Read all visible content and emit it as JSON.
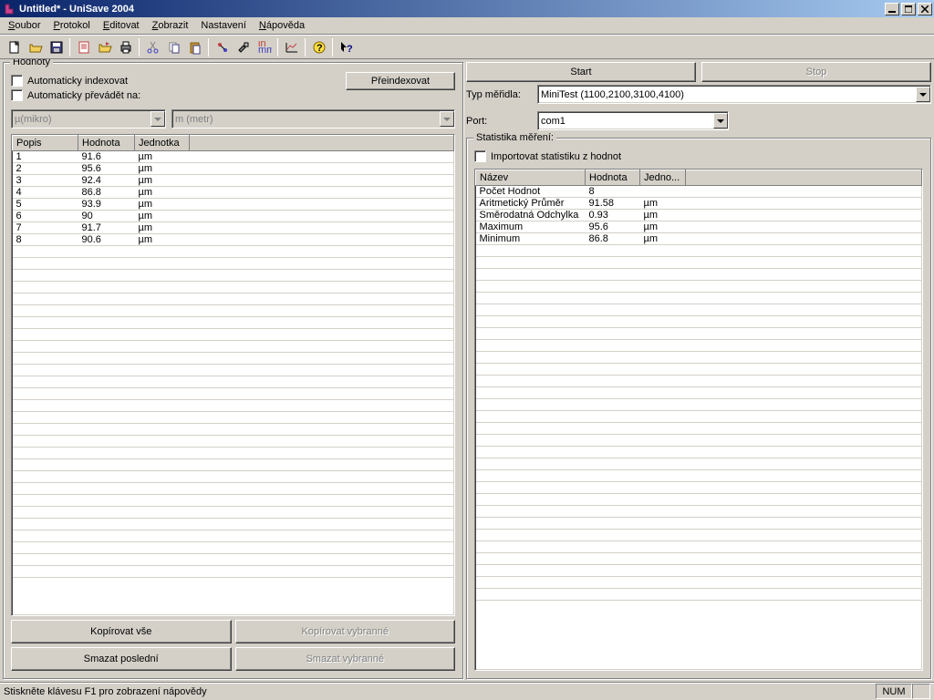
{
  "window": {
    "title": "Untitled* - UniSave 2004"
  },
  "menu": {
    "items": [
      {
        "label": "Soubor",
        "u": 0
      },
      {
        "label": "Protokol",
        "u": 0
      },
      {
        "label": "Editovat",
        "u": 0
      },
      {
        "label": "Zobrazit",
        "u": 0
      },
      {
        "label": "Nastavení",
        "u": -1
      },
      {
        "label": "Nápověda",
        "u": 0
      }
    ]
  },
  "left": {
    "group_title": "Hodnoty",
    "auto_index": "Automaticky indexovat",
    "reindex": "Přeindexovat",
    "auto_convert": "Automaticky převádět na:",
    "unit1": "µ(mikro)",
    "unit2": "m (metr)",
    "cols": [
      "Popis",
      "Hodnota",
      "Jednotka"
    ],
    "rows": [
      {
        "popis": "1",
        "hodnota": "91.6",
        "jednotka": "µm"
      },
      {
        "popis": "2",
        "hodnota": "95.6",
        "jednotka": "µm"
      },
      {
        "popis": "3",
        "hodnota": "92.4",
        "jednotka": "µm"
      },
      {
        "popis": "4",
        "hodnota": "86.8",
        "jednotka": "µm"
      },
      {
        "popis": "5",
        "hodnota": "93.9",
        "jednotka": "µm"
      },
      {
        "popis": "6",
        "hodnota": "90",
        "jednotka": "µm"
      },
      {
        "popis": "7",
        "hodnota": "91.7",
        "jednotka": "µm"
      },
      {
        "popis": "8",
        "hodnota": "90.6",
        "jednotka": "µm"
      }
    ],
    "btn_copy_all": "Kopírovat vše",
    "btn_copy_sel": "Kopírovat vybranné",
    "btn_del_last": "Smazat poslední",
    "btn_del_sel": "Smazat vybranné"
  },
  "right": {
    "btn_start": "Start",
    "btn_stop": "Stop",
    "label_device": "Typ měřidla:",
    "device": "MiniTest (1100,2100,3100,4100)",
    "label_port": "Port:",
    "port": "com1",
    "stats_title": "Statistika měření:",
    "import_stats": "Importovat statistiku z hodnot",
    "stats_cols": [
      "Název",
      "Hodnota",
      "Jedno..."
    ],
    "stats_rows": [
      {
        "n": "Počet Hodnot",
        "h": "8",
        "j": ""
      },
      {
        "n": "Aritmetický Průměr",
        "h": "91.58",
        "j": "µm"
      },
      {
        "n": "Směrodatná Odchylka",
        "h": "0.93",
        "j": "µm"
      },
      {
        "n": "Maximum",
        "h": "95.6",
        "j": "µm"
      },
      {
        "n": "Minimum",
        "h": "86.8",
        "j": "µm"
      }
    ]
  },
  "statusbar": {
    "hint": "Stiskněte klávesu F1 pro zobrazení nápovědy",
    "num": "NUM"
  }
}
